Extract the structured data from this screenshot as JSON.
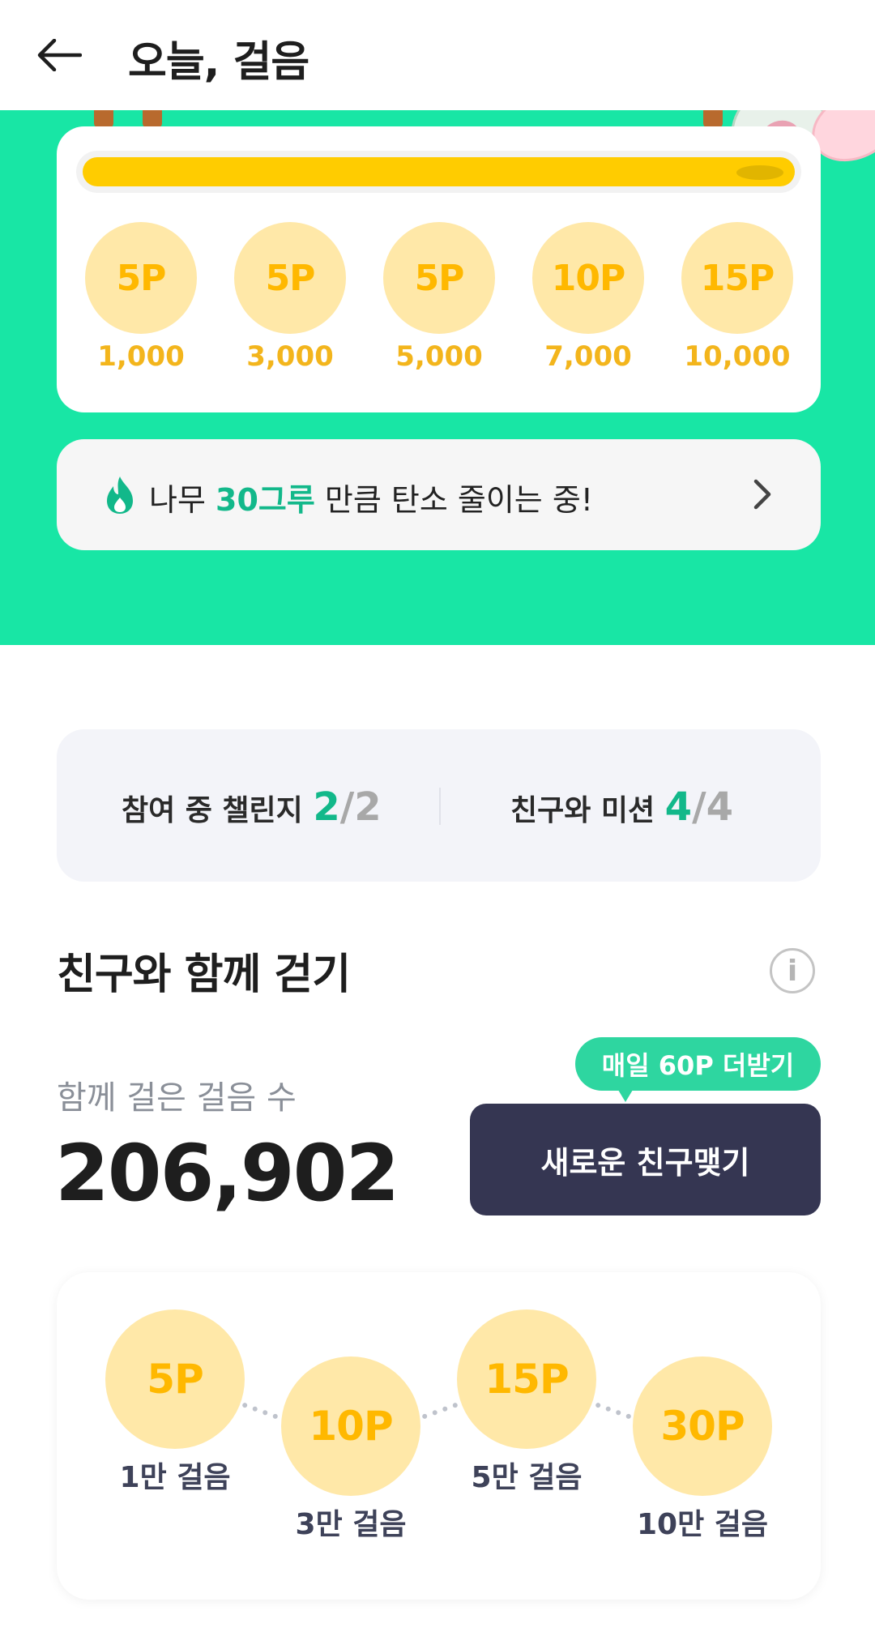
{
  "header": {
    "title": "오늘, 걸음"
  },
  "hero": {
    "progress": 1.0,
    "milestones": [
      {
        "points": "5P",
        "steps": "1,000"
      },
      {
        "points": "5P",
        "steps": "3,000"
      },
      {
        "points": "5P",
        "steps": "5,000"
      },
      {
        "points": "10P",
        "steps": "7,000"
      },
      {
        "points": "15P",
        "steps": "10,000"
      }
    ],
    "carbon": {
      "prefix": "나무 ",
      "highlight": "30그루",
      "suffix": " 만큼 탄소 줄이는 중!"
    }
  },
  "stats": {
    "challenge": {
      "label": "참여 중 챌린지 ",
      "current": "2",
      "sep": "/",
      "total": "2"
    },
    "mission": {
      "label": "친구와 미션 ",
      "current": "4",
      "sep": "/",
      "total": "4"
    }
  },
  "walk_together": {
    "title": "친구와 함께 걷기",
    "info_icon": "i",
    "steps_label": "함께 걸은 걸음 수",
    "steps_value": "206,902",
    "bonus_badge": "매일 60P 더받기",
    "new_friend_button": "새로운 친구맺기",
    "rewards": [
      {
        "points": "5P",
        "label": "1만 걸음"
      },
      {
        "points": "10P",
        "label": "3만 걸음"
      },
      {
        "points": "15P",
        "label": "5만 걸음"
      },
      {
        "points": "30P",
        "label": "10만 걸음"
      }
    ]
  },
  "colors": {
    "accent": "#18e6a5",
    "coin": "#ffe8a8",
    "coinText": "#ffb800",
    "button": "#353652"
  }
}
